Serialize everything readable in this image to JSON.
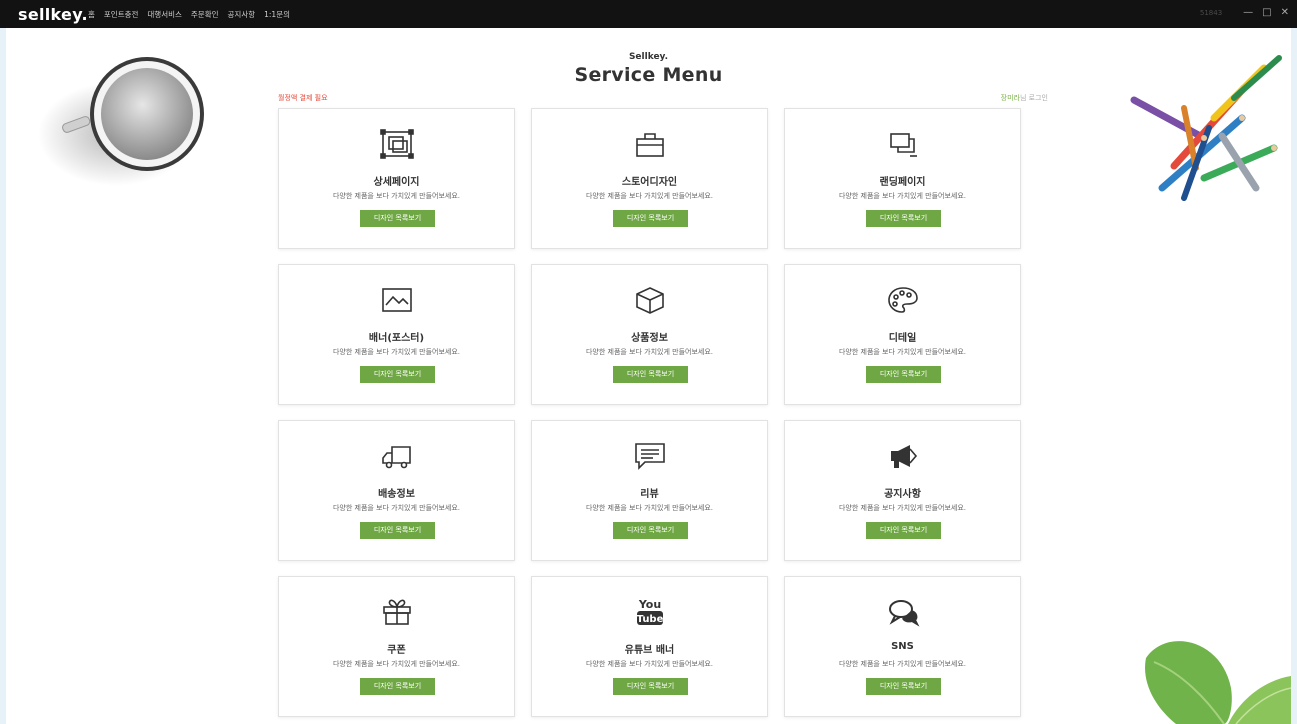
{
  "titlebar": {
    "logo": "sellkey.",
    "nav": [
      "홈",
      "포인트충전",
      "대행서비스",
      "주문확인",
      "공지사항",
      "1:1문의"
    ],
    "sys_number": "51843"
  },
  "header": {
    "brand": "Sellkey.",
    "title": "Service Menu",
    "payment_notice": "월정액 결제 필요",
    "user_name": "장미라",
    "user_suffix": "님 로그인"
  },
  "cards": [
    {
      "title": "상세페이지",
      "desc": "다양한 제품을 보다 가치있게 만들어보세요.",
      "button": "디자인 목록보기",
      "icon": "detail-page-icon"
    },
    {
      "title": "스토어디자인",
      "desc": "다양한 제품을 보다 가치있게 만들어보세요.",
      "button": "디자인 목록보기",
      "icon": "store-bag-icon"
    },
    {
      "title": "랜딩페이지",
      "desc": "다양한 제품을 보다 가치있게 만들어보세요.",
      "button": "디자인 목록보기",
      "icon": "landing-pages-icon"
    },
    {
      "title": "배너(포스터)",
      "desc": "다양한 제품을 보다 가치있게 만들어보세요.",
      "button": "디자인 목록보기",
      "icon": "banner-image-icon"
    },
    {
      "title": "상품정보",
      "desc": "다양한 제품을 보다 가치있게 만들어보세요.",
      "button": "디자인 목록보기",
      "icon": "product-box-icon"
    },
    {
      "title": "디테일",
      "desc": "다양한 제품을 보다 가치있게 만들어보세요.",
      "button": "디자인 목록보기",
      "icon": "palette-icon"
    },
    {
      "title": "배송정보",
      "desc": "다양한 제품을 보다 가치있게 만들어보세요.",
      "button": "디자인 목록보기",
      "icon": "delivery-truck-icon"
    },
    {
      "title": "리뷰",
      "desc": "다양한 제품을 보다 가치있게 만들어보세요.",
      "button": "디자인 목록보기",
      "icon": "review-chat-icon"
    },
    {
      "title": "공지사항",
      "desc": "다양한 제품을 보다 가치있게 만들어보세요.",
      "button": "디자인 목록보기",
      "icon": "megaphone-icon"
    },
    {
      "title": "쿠폰",
      "desc": "다양한 제품을 보다 가치있게 만들어보세요.",
      "button": "디자인 목록보기",
      "icon": "gift-icon"
    },
    {
      "title": "유튜브 배너",
      "desc": "다양한 제품을 보다 가치있게 만들어보세요.",
      "button": "디자인 목록보기",
      "icon": "youtube-icon",
      "icon_text": [
        "You",
        "Tube"
      ]
    },
    {
      "title": "SNS",
      "desc": "다양한 제품을 보다 가치있게 만들어보세요.",
      "button": "디자인 목록보기",
      "icon": "sns-chat-icon"
    }
  ],
  "colors": {
    "titlebar_bg": "#121212",
    "accent_button": "#6fa744",
    "notice_red": "#e54a3a",
    "user_green": "#7bb24a",
    "page_bg": "#e7f1f8"
  }
}
